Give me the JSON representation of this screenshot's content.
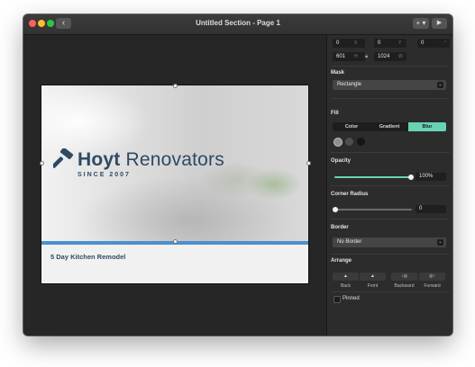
{
  "window": {
    "title": "Untitled Section - Page 1",
    "back_icon": "‹",
    "add_label": "+ ▾",
    "play_icon": "▶"
  },
  "slide": {
    "brand_bold": "Hoyt",
    "brand_light": "Renovators",
    "tagline": "SINCE 2007",
    "caption": "5 Day Kitchen Remodel",
    "logo_icon": "hammer-icon",
    "brand_color": "#2e4a63",
    "accent_color": "#4d8fd0"
  },
  "inspector": {
    "position": {
      "x": "0",
      "x_unit": "X",
      "y": "0",
      "y_unit": "Y",
      "rotation": "0",
      "rotation_unit": "°"
    },
    "size": {
      "height": "601",
      "height_unit": "H",
      "width": "1024",
      "width_unit": "W",
      "lock_icon": "lock-icon"
    },
    "mask": {
      "label": "Mask",
      "value": "Rectangle"
    },
    "fill": {
      "label": "Fill",
      "tabs": [
        "Color",
        "Gradient",
        "Blur"
      ],
      "active_tab": "Blur",
      "swatch_colors": [
        "#8e8e8e",
        "#4e4e4e",
        "#151515"
      ]
    },
    "opacity": {
      "label": "Opacity",
      "value": "100%",
      "level": 1.0
    },
    "corner_radius": {
      "label": "Corner Radius",
      "value": "0",
      "level": 0.0
    },
    "border": {
      "label": "Border",
      "value": "No Border"
    },
    "arrange": {
      "label": "Arrange",
      "buttons": [
        {
          "icon": "▲",
          "label": "Back"
        },
        {
          "icon": "▲",
          "label": "Front"
        },
        {
          "icon": "↓◎",
          "label": "Backward"
        },
        {
          "icon": "◎↑",
          "label": "Forward"
        }
      ]
    },
    "pinned": {
      "label": "Pinned",
      "checked": false
    },
    "accent_color": "#68d3b5"
  }
}
